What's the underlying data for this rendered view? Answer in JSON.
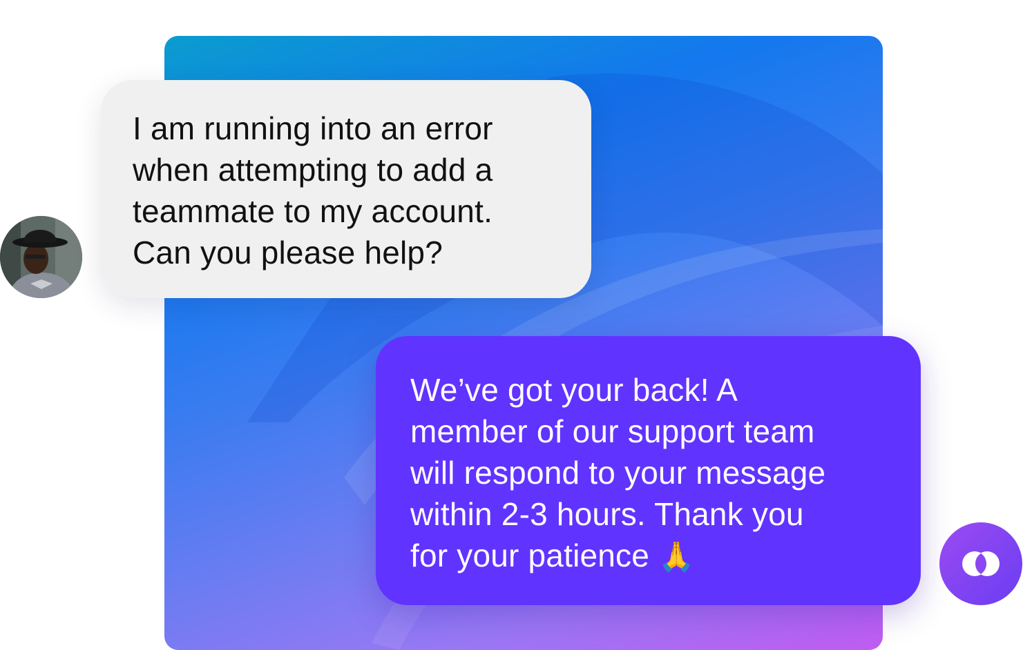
{
  "conversation": {
    "customer": {
      "avatar_icon": "person-avatar-icon",
      "message_lines": [
        "I am running into an error",
        "when attempting to add a",
        "teammate to my account.",
        "Can you please help?"
      ]
    },
    "agent": {
      "logo_icon": "brand-logo-icon",
      "message_lines": [
        "We’ve got your back! A",
        "member of our support team",
        "will respond to your message",
        "within 2-3 hours. Thank you",
        "for your patience"
      ],
      "emoji": "🙏"
    }
  },
  "colors": {
    "customer_bubble": "#f0f0f0",
    "agent_bubble": "#6133ff",
    "backdrop_start": "#0a9ccf",
    "backdrop_end": "#c15cf2",
    "logo": "#7a44f2"
  }
}
